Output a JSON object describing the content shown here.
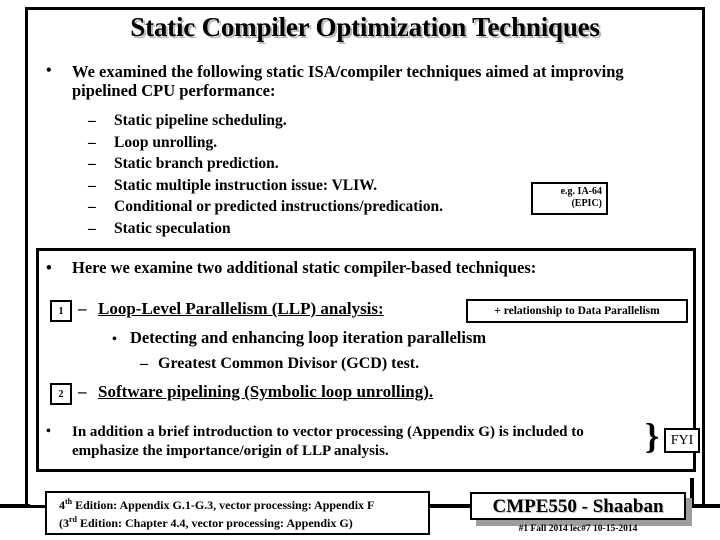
{
  "slide": {
    "title": "Static Compiler Optimization Techniques",
    "upper_section": {
      "bullet_marker": "•",
      "intro": "We examined the following static ISA/compiler techniques aimed at improving pipelined CPU performance:",
      "dash_marker": "–",
      "items": [
        "Static pipeline scheduling.",
        "Loop unrolling.",
        "Static branch prediction.",
        "Static multiple instruction issue:  VLIW.",
        "Conditional or predicted instructions/predication.",
        "Static speculation"
      ],
      "epic_callout": {
        "line1": "e.g. IA-64",
        "line2": "(EPIC)"
      }
    },
    "lower_section": {
      "bullet_marker": "•",
      "dash_marker": "–",
      "intro": "Here we examine two additional static compiler-based techniques:",
      "numbered": [
        {
          "number": "1",
          "label": "Loop-Level Parallelism (LLP) analysis:"
        },
        {
          "number": "2",
          "label": "Software pipelining (Symbolic loop unrolling)."
        }
      ],
      "relationship_callout": "+ relationship to Data Parallelism",
      "detect_bullet": "•",
      "detect_text": "Detecting and enhancing loop iteration parallelism",
      "gcd_dash": "–",
      "gcd_text": "Greatest Common Divisor (GCD) test.",
      "vector_note": "In addition a brief introduction to vector processing (Appendix G) is included to emphasize the importance/origin of LLP analysis.",
      "brace_glyph": "}",
      "fyi_label": "FYI"
    },
    "footer": {
      "footnote_line1_pre": "4",
      "footnote_line1_sup": "th",
      "footnote_line1_post": " Edition: Appendix G.1-G.3, vector processing: Appendix F",
      "footnote_line2_pre": "(3",
      "footnote_line2_sup": "rd",
      "footnote_line2_post": " Edition: Chapter 4.4, vector processing: Appendix G)",
      "course": "CMPE550 - Shaaban",
      "meta": "#1  Fall 2014  lec#7   10-15-2014"
    },
    "colors": {
      "background": "#ffffff",
      "foreground": "#000000",
      "shadow": "#b9b9b9",
      "box_shadow": "#9d9d9d"
    }
  }
}
